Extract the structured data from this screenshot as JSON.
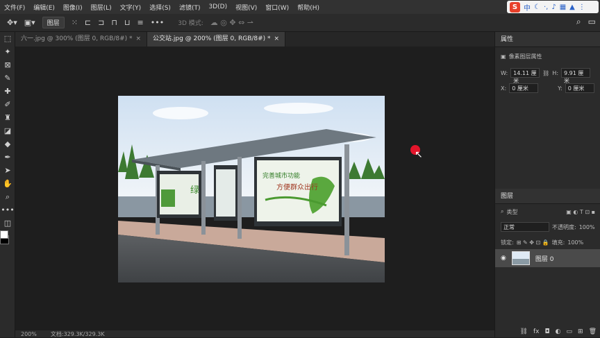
{
  "menu": [
    "文件(F)",
    "编辑(E)",
    "图像(I)",
    "图层(L)",
    "文字(Y)",
    "选择(S)",
    "滤镜(T)",
    "3D(D)",
    "视图(V)",
    "窗口(W)",
    "帮助(H)"
  ],
  "ime": {
    "logo": "S",
    "mode": "中"
  },
  "options": {
    "layer_select": "图层",
    "mode_3d": "3D 模式:"
  },
  "tabs": [
    {
      "label": "六一.jpg @ 300% (图层 0, RGB/8#) *",
      "close": "×"
    },
    {
      "label": "公交站.jpg @ 200% (图层 0, RGB/8#) *",
      "close": "×"
    }
  ],
  "status": {
    "zoom": "200%",
    "doc": "文档:329.3K/329.3K"
  },
  "properties": {
    "title": "属性",
    "subtitle": "像素图层属性",
    "w_label": "W:",
    "w_value": "14.11 厘米",
    "h_label": "H:",
    "h_value": "9.91 厘米",
    "x_label": "X:",
    "x_value": "0 厘米",
    "y_label": "Y:",
    "y_value": "0 厘米"
  },
  "layers": {
    "title": "图层",
    "kind": "类型",
    "blend": "正常",
    "opacity_label": "不透明度:",
    "opacity_value": "100%",
    "lock_label": "锁定:",
    "fill_label": "填充:",
    "fill_value": "100%",
    "layer_name": "图层 0"
  },
  "photo": {
    "ad_left_text": "绿",
    "ad_right_line1": "完善城市功能",
    "ad_right_line2": "方便群众出行"
  }
}
